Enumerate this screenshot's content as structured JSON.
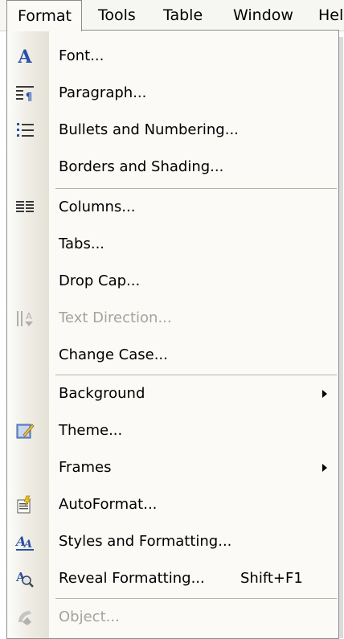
{
  "menubar": {
    "items": [
      {
        "label": "Format"
      },
      {
        "label": "Tools"
      },
      {
        "label": "Table"
      },
      {
        "label": "Window"
      },
      {
        "label": "Hel"
      }
    ]
  },
  "format_menu": {
    "items": [
      {
        "label": "Font...",
        "icon": "font-A-icon"
      },
      {
        "label": "Paragraph...",
        "icon": "paragraph-icon"
      },
      {
        "label": "Bullets and Numbering...",
        "icon": "bullets-icon"
      },
      {
        "label": "Borders and Shading...",
        "icon": null
      },
      {
        "label": "Columns...",
        "icon": "columns-icon"
      },
      {
        "label": "Tabs...",
        "icon": null
      },
      {
        "label": "Drop Cap...",
        "icon": null
      },
      {
        "label": "Text Direction...",
        "icon": "text-direction-icon",
        "disabled": true
      },
      {
        "label": "Change Case...",
        "icon": null
      },
      {
        "label": "Background",
        "icon": null,
        "submenu": true
      },
      {
        "label": "Theme...",
        "icon": "theme-icon"
      },
      {
        "label": "Frames",
        "icon": null,
        "submenu": true
      },
      {
        "label": "AutoFormat...",
        "icon": "autoformat-icon"
      },
      {
        "label": "Styles and Formatting...",
        "icon": "styles-formatting-icon"
      },
      {
        "label": "Reveal Formatting...",
        "icon": "reveal-formatting-icon",
        "shortcut": "Shift+F1"
      },
      {
        "label": "Object...",
        "icon": "object-icon",
        "disabled": true
      }
    ]
  },
  "colors": {
    "menu_bg": "#fbfaf7",
    "disabled_text": "#a4a39c",
    "icon_blue": "#2a4fa8"
  }
}
